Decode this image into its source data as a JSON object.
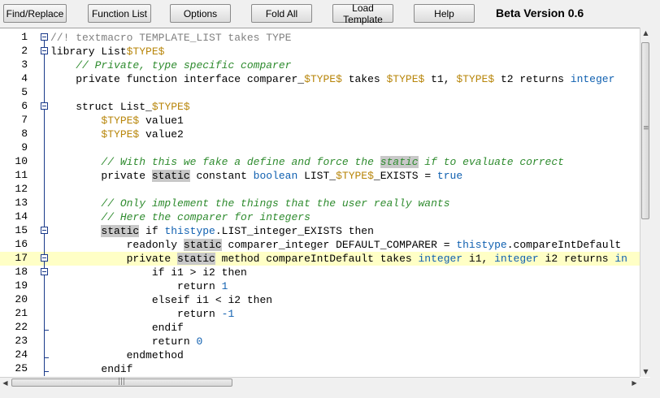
{
  "toolbar": {
    "buttons": [
      {
        "label": "Find/Replace"
      },
      {
        "label": "Function List"
      },
      {
        "label": "Options"
      },
      {
        "label": "Fold All"
      },
      {
        "label": "Load Template"
      },
      {
        "label": "Help"
      }
    ],
    "version": "Beta Version 0.6"
  },
  "colors": {
    "comment": "#2e8b2e",
    "macro": "#b8860b",
    "type": "#1060b0",
    "highlight_line": "#ffffc6",
    "word_highlight": "#c8c8c8"
  },
  "editor": {
    "current_line": 17,
    "lines": [
      {
        "n": "1",
        "fold": "box-first",
        "tokens": [
          {
            "c": "t-gc",
            "t": "//! textmacro TEMPLATE_LIST takes TYPE"
          }
        ]
      },
      {
        "n": "2",
        "fold": "box",
        "tokens": [
          {
            "c": "t-kw",
            "t": "library List"
          },
          {
            "c": "t-mac",
            "t": "$TYPE$"
          }
        ]
      },
      {
        "n": "3",
        "fold": "line",
        "tokens": [
          {
            "c": "",
            "t": "    "
          },
          {
            "c": "t-cm",
            "t": "// Private, type specific comparer"
          }
        ]
      },
      {
        "n": "4",
        "fold": "line",
        "tokens": [
          {
            "c": "",
            "t": "    "
          },
          {
            "c": "t-kw",
            "t": "private function interface comparer_"
          },
          {
            "c": "t-mac",
            "t": "$TYPE$"
          },
          {
            "c": "t-kw",
            "t": " takes "
          },
          {
            "c": "t-mac",
            "t": "$TYPE$"
          },
          {
            "c": "t-kw",
            "t": " t1, "
          },
          {
            "c": "t-mac",
            "t": "$TYPE$"
          },
          {
            "c": "t-kw",
            "t": " t2 returns "
          },
          {
            "c": "t-ty",
            "t": "integer"
          }
        ]
      },
      {
        "n": "5",
        "fold": "line",
        "tokens": []
      },
      {
        "n": "6",
        "fold": "box",
        "tokens": [
          {
            "c": "",
            "t": "    "
          },
          {
            "c": "t-kw",
            "t": "struct List_"
          },
          {
            "c": "t-mac",
            "t": "$TYPE$"
          }
        ]
      },
      {
        "n": "7",
        "fold": "line",
        "tokens": [
          {
            "c": "",
            "t": "        "
          },
          {
            "c": "t-mac",
            "t": "$TYPE$"
          },
          {
            "c": "t-kw",
            "t": " value1"
          }
        ]
      },
      {
        "n": "8",
        "fold": "line",
        "tokens": [
          {
            "c": "",
            "t": "        "
          },
          {
            "c": "t-mac",
            "t": "$TYPE$"
          },
          {
            "c": "t-kw",
            "t": " value2"
          }
        ]
      },
      {
        "n": "9",
        "fold": "line",
        "tokens": []
      },
      {
        "n": "10",
        "fold": "line",
        "tokens": [
          {
            "c": "",
            "t": "        "
          },
          {
            "c": "t-cm",
            "t": "// With this we fake a define and force the "
          },
          {
            "c": "t-cm t-st",
            "t": "static"
          },
          {
            "c": "t-cm",
            "t": " if to evaluate correct"
          }
        ]
      },
      {
        "n": "11",
        "fold": "line",
        "tokens": [
          {
            "c": "",
            "t": "        "
          },
          {
            "c": "t-kw",
            "t": "private "
          },
          {
            "c": "t-kw t-st",
            "t": "static"
          },
          {
            "c": "t-kw",
            "t": " constant "
          },
          {
            "c": "t-ty",
            "t": "boolean"
          },
          {
            "c": "t-kw",
            "t": " LIST_"
          },
          {
            "c": "t-mac",
            "t": "$TYPE$"
          },
          {
            "c": "t-kw",
            "t": "_EXISTS = "
          },
          {
            "c": "t-ty",
            "t": "true"
          }
        ]
      },
      {
        "n": "12",
        "fold": "line",
        "tokens": []
      },
      {
        "n": "13",
        "fold": "line",
        "tokens": [
          {
            "c": "",
            "t": "        "
          },
          {
            "c": "t-cm",
            "t": "// Only implement the things that the user really wants"
          }
        ]
      },
      {
        "n": "14",
        "fold": "line",
        "tokens": [
          {
            "c": "",
            "t": "        "
          },
          {
            "c": "t-cm",
            "t": "// Here the comparer for integers"
          }
        ]
      },
      {
        "n": "15",
        "fold": "box",
        "tokens": [
          {
            "c": "",
            "t": "        "
          },
          {
            "c": "t-kw t-st",
            "t": "static"
          },
          {
            "c": "t-kw",
            "t": " if "
          },
          {
            "c": "t-ty",
            "t": "thistype"
          },
          {
            "c": "t-kw",
            "t": ".LIST_integer_EXISTS then"
          }
        ]
      },
      {
        "n": "16",
        "fold": "line",
        "tokens": [
          {
            "c": "",
            "t": "            "
          },
          {
            "c": "t-kw",
            "t": "readonly "
          },
          {
            "c": "t-kw t-st",
            "t": "static"
          },
          {
            "c": "t-kw",
            "t": " comparer_integer DEFAULT_COMPARER = "
          },
          {
            "c": "t-ty",
            "t": "thistype"
          },
          {
            "c": "t-kw",
            "t": ".compareIntDefault"
          }
        ]
      },
      {
        "n": "17",
        "fold": "box",
        "tokens": [
          {
            "c": "",
            "t": "            "
          },
          {
            "c": "t-kw",
            "t": "private "
          },
          {
            "c": "t-kw t-st",
            "t": "static"
          },
          {
            "c": "t-kw",
            "t": " method compareIntDefault takes "
          },
          {
            "c": "t-ty",
            "t": "integer"
          },
          {
            "c": "t-kw",
            "t": " i1, "
          },
          {
            "c": "t-ty",
            "t": "integer"
          },
          {
            "c": "t-kw",
            "t": " i2 returns "
          },
          {
            "c": "t-ty",
            "t": "in"
          }
        ]
      },
      {
        "n": "18",
        "fold": "box",
        "tokens": [
          {
            "c": "",
            "t": "                "
          },
          {
            "c": "t-kw",
            "t": "if i1 > i2 then"
          }
        ]
      },
      {
        "n": "19",
        "fold": "line",
        "tokens": [
          {
            "c": "",
            "t": "                    "
          },
          {
            "c": "t-kw",
            "t": "return "
          },
          {
            "c": "t-num",
            "t": "1"
          }
        ]
      },
      {
        "n": "20",
        "fold": "line",
        "tokens": [
          {
            "c": "",
            "t": "                "
          },
          {
            "c": "t-kw",
            "t": "elseif i1 < i2 then"
          }
        ]
      },
      {
        "n": "21",
        "fold": "line",
        "tokens": [
          {
            "c": "",
            "t": "                    "
          },
          {
            "c": "t-kw",
            "t": "return "
          },
          {
            "c": "t-num",
            "t": "-1"
          }
        ]
      },
      {
        "n": "22",
        "fold": "end",
        "tokens": [
          {
            "c": "",
            "t": "                "
          },
          {
            "c": "t-kw",
            "t": "endif"
          }
        ]
      },
      {
        "n": "23",
        "fold": "line",
        "tokens": [
          {
            "c": "",
            "t": "                "
          },
          {
            "c": "t-kw",
            "t": "return "
          },
          {
            "c": "t-num",
            "t": "0"
          }
        ]
      },
      {
        "n": "24",
        "fold": "end",
        "tokens": [
          {
            "c": "",
            "t": "            "
          },
          {
            "c": "t-kw",
            "t": "endmethod"
          }
        ]
      },
      {
        "n": "25",
        "fold": "end",
        "tokens": [
          {
            "c": "",
            "t": "        "
          },
          {
            "c": "t-kw",
            "t": "endif"
          }
        ]
      }
    ]
  },
  "scrollbars": {
    "up_icon": "arrow-up-icon",
    "down_icon": "arrow-down-icon",
    "left_icon": "arrow-left-icon",
    "right_icon": "arrow-right-icon"
  }
}
